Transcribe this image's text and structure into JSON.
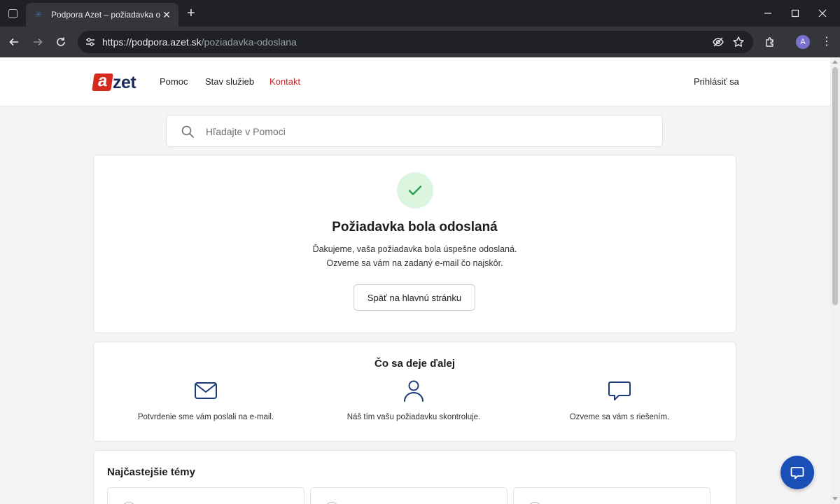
{
  "browser": {
    "tab_title": "Podpora Azet – požiadavka odoslaná",
    "url_host": "https://podpora.azet.sk",
    "url_path": "/poziadavka-odoslana",
    "profile_initial": "A"
  },
  "header": {
    "logo_a": "a",
    "logo_rest": "zet",
    "nav": [
      "Pomoc",
      "Stav služieb",
      "Kontakt"
    ],
    "active_nav": "Kontakt",
    "login_label": "Prihlásiť sa"
  },
  "search": {
    "placeholder": "Hľadajte v Pomoci"
  },
  "confirmation": {
    "title": "Požiadavka bola odoslaná",
    "line1": "Ďakujeme, vaša požiadavka bola úspešne odoslaná.",
    "line2": "Ozveme sa vám na zadaný e-mail čo najskôr.",
    "button_label": "Späť na hlavnú stránku",
    "status_color": "#2e9e4f"
  },
  "next_steps": {
    "title": "Čo sa deje ďalej",
    "steps": [
      {
        "icon": "envelope-icon",
        "text": "Potvrdenie sme vám poslali na e-mail."
      },
      {
        "icon": "person-icon",
        "text": "Náš tím vašu požiadavku skontroluje."
      },
      {
        "icon": "chat-bubble-icon",
        "text": "Ozveme sa vám s riešením."
      }
    ],
    "icon_color": "#1b3a7a"
  },
  "topics": {
    "title": "Najčastejšie témy"
  },
  "colors": {
    "brand_red": "#c7262b",
    "brand_navy": "#1b2a5b",
    "chat_button": "#1a4fb8"
  }
}
